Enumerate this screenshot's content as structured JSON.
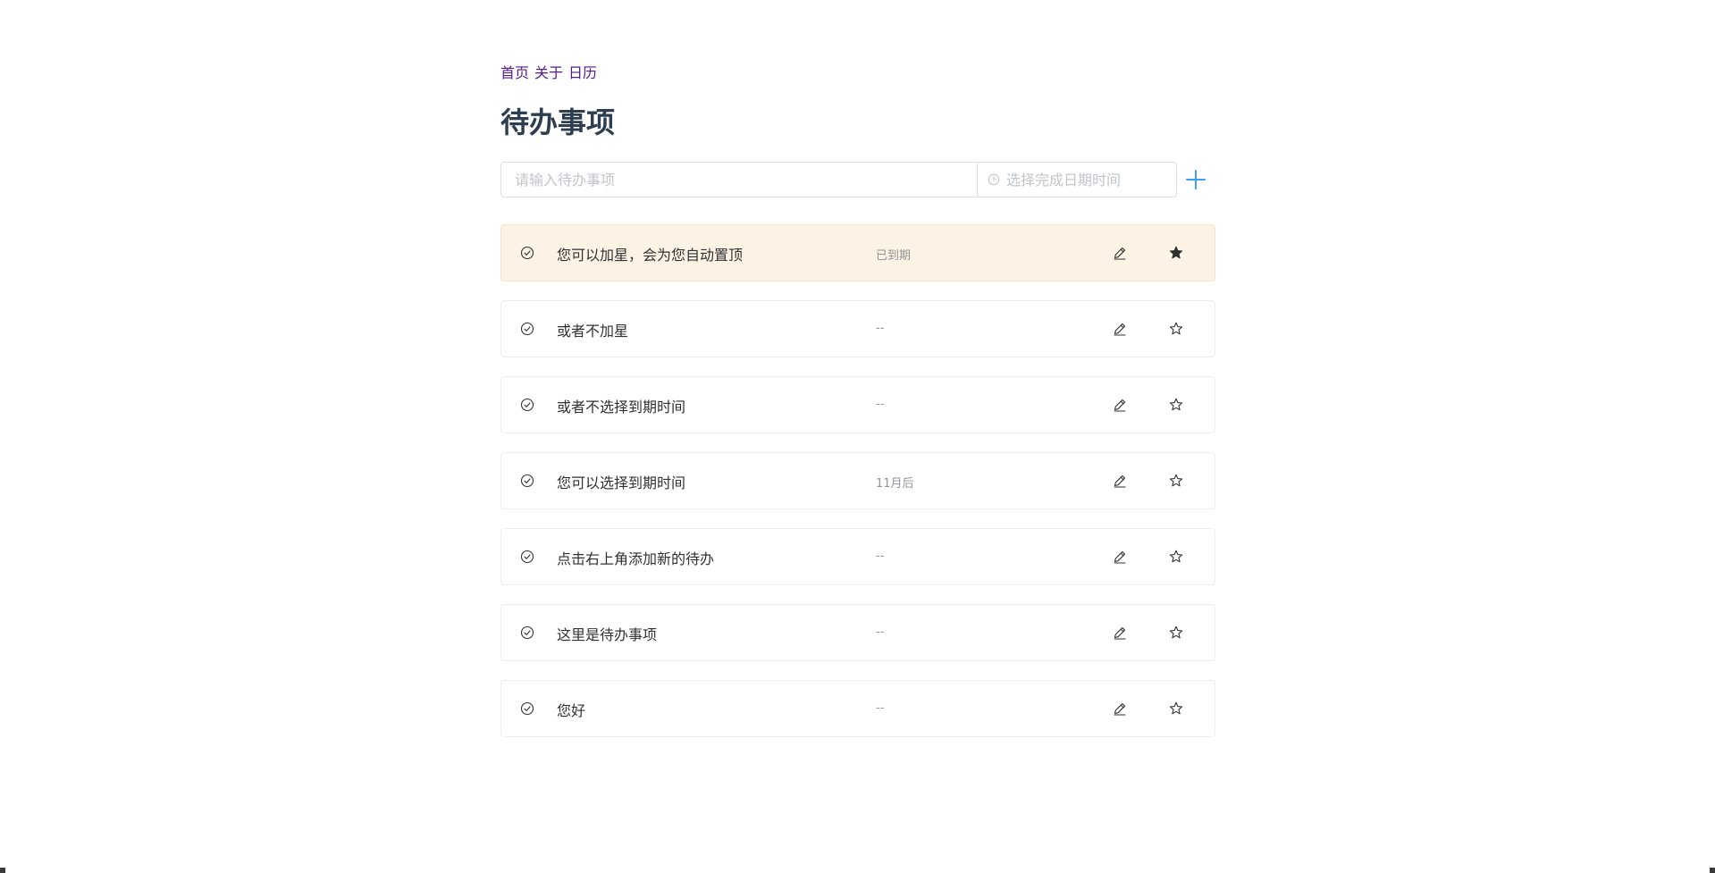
{
  "nav": {
    "items": [
      {
        "label": "首页"
      },
      {
        "label": "关于"
      },
      {
        "label": "日历"
      }
    ]
  },
  "page_title": "待办事项",
  "add_form": {
    "todo_placeholder": "请输入待办事项",
    "todo_value": "",
    "date_placeholder": "选择完成日期时间",
    "date_value": "",
    "add_icon": "plus-icon"
  },
  "colors": {
    "starred_bg": "#fdf3e4",
    "accent": "#409eff",
    "nav_link": "#551a8b",
    "title": "#2c3e50"
  },
  "todos": [
    {
      "text": "您可以加星，会为您自动置顶",
      "due": "已到期",
      "starred": true
    },
    {
      "text": "或者不加星",
      "due": "--",
      "starred": false
    },
    {
      "text": "或者不选择到期时间",
      "due": "--",
      "starred": false
    },
    {
      "text": "您可以选择到期时间",
      "due": "11月后",
      "starred": false
    },
    {
      "text": "点击右上角添加新的待办",
      "due": "--",
      "starred": false
    },
    {
      "text": "这里是待办事项",
      "due": "--",
      "starred": false
    },
    {
      "text": "您好",
      "due": "--",
      "starred": false
    }
  ]
}
